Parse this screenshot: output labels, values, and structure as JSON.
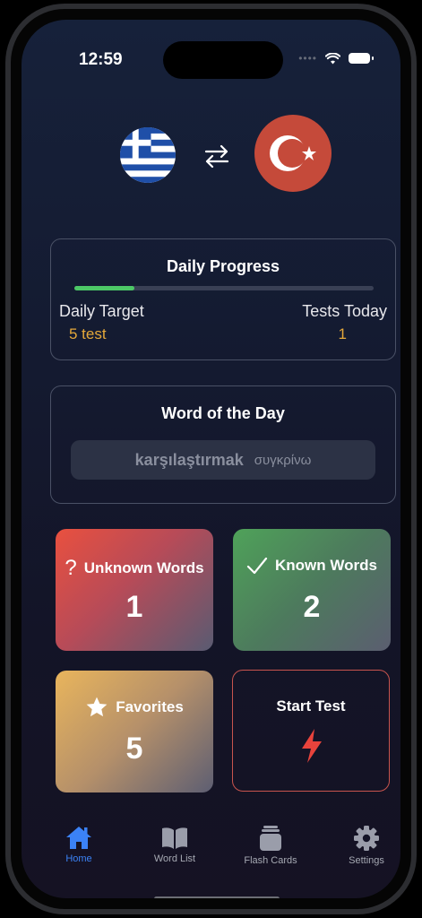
{
  "status_bar": {
    "time": "12:59"
  },
  "languages": {
    "source": "Greek",
    "target": "Turkish"
  },
  "daily_progress": {
    "title": "Daily Progress",
    "progress_fraction": 0.2,
    "target_label": "Daily Target",
    "target_value": "5 test",
    "tests_label": "Tests Today",
    "tests_value": "1"
  },
  "word_of_day": {
    "title": "Word of the Day",
    "word": "karşılaştırmak",
    "translation": "συγκρίνω"
  },
  "tiles": {
    "unknown": {
      "title": "Unknown Words",
      "count": "1",
      "icon": "question-icon"
    },
    "known": {
      "title": "Known Words",
      "count": "2",
      "icon": "checkmark-icon"
    },
    "favorites": {
      "title": "Favorites",
      "count": "5",
      "icon": "star-icon"
    },
    "start": {
      "title": "Start Test",
      "icon": "lightning-icon"
    }
  },
  "tabbar": {
    "items": [
      {
        "label": "Home",
        "icon": "house-icon",
        "active": true
      },
      {
        "label": "Word List",
        "icon": "book-icon",
        "active": false
      },
      {
        "label": "Flash Cards",
        "icon": "cards-icon",
        "active": false
      },
      {
        "label": "Settings",
        "icon": "gear-icon",
        "active": false
      }
    ]
  },
  "colors": {
    "accent_blue": "#3b82f6",
    "progress_green": "#4cc866",
    "value_orange": "#e4a83a",
    "start_border": "#c8544e",
    "bolt_red": "#e8433c"
  }
}
